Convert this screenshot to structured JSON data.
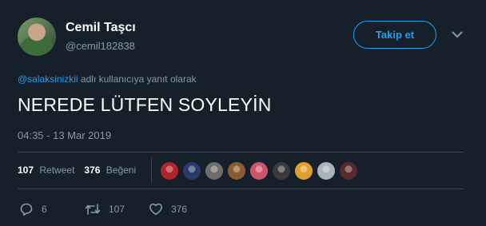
{
  "author": {
    "display_name": "Cemil Taşcı",
    "handle": "@cemil182838"
  },
  "follow_button": {
    "label": "Takip et"
  },
  "reply_context": {
    "mention": "@salaksinizkii",
    "suffix": "adlı kullanıcıya yanıt olarak"
  },
  "tweet": {
    "text": "NEREDE LÜTFEN SOYLEYİN",
    "timestamp": "04:35 - 13 Mar 2019"
  },
  "stats": {
    "retweets": "107",
    "retweets_label": "Retweet",
    "likes": "376",
    "likes_label": "Beğeni"
  },
  "likers": [
    {
      "color": "#b0232a"
    },
    {
      "color": "#2a3a6a"
    },
    {
      "color": "#6e6e6e"
    },
    {
      "color": "#8a5a30"
    },
    {
      "color": "#d0546a"
    },
    {
      "color": "#3a3a3a"
    },
    {
      "color": "#e0a030"
    },
    {
      "color": "#aab4bd"
    },
    {
      "color": "#5a2a2a"
    }
  ],
  "actions": {
    "replies": "6",
    "retweets": "107",
    "likes": "376"
  },
  "colors": {
    "background": "#15202b",
    "accent": "#1da1f2",
    "muted": "#8899a6",
    "divider": "#38444d"
  }
}
